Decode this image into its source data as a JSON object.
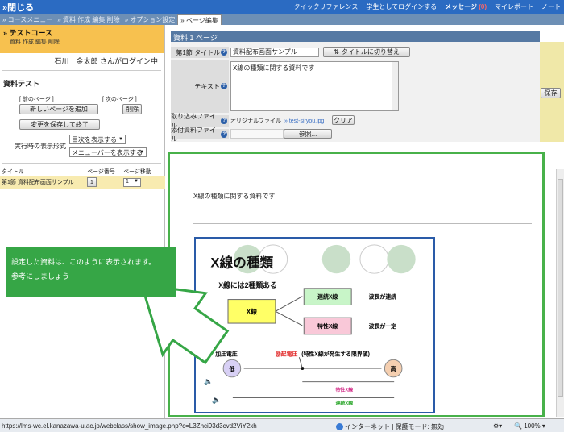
{
  "topbar": {
    "close": "»閉じる",
    "quick_ref": "クイックリファレンス",
    "student_login": "学生としてログインする",
    "messages": "メッセージ",
    "message_count": "(0)",
    "my_report": "マイレポート",
    "note": "ノート"
  },
  "tabs": [
    {
      "label": "» コースメニュー"
    },
    {
      "label": "» 資料 作成 編集 削除"
    },
    {
      "label": "» オプション設定"
    },
    {
      "label": "» ページ編集"
    }
  ],
  "course": {
    "title": "» テストコース",
    "subtitle": "資料 作成 編集 削除",
    "login": "石川　金太郎 さんがログイン中"
  },
  "material": {
    "title": "資料テスト",
    "prev_page": "[ 前のページ ]",
    "next_page": "[ 次のページ ]",
    "add_page": "新しいページを追加",
    "delete": "削除",
    "save_finish": "変更を保存して終了",
    "display_format_label": "実行時の表示形式",
    "toc_option": "目次を表示する",
    "menu_option": "メニューバーを表示する"
  },
  "page_table": {
    "col_title": "タイトル",
    "col_pageno": "ページ番号",
    "col_move": "ページ移動",
    "rows": [
      {
        "title": "第1節 資料配布画面サンプル",
        "pageno": "1",
        "move": "1"
      }
    ]
  },
  "editor": {
    "header": "資料 1 ページ",
    "title_label": "第1節 タイトル",
    "title_value": "資料配布画面サンプル",
    "switch_title": "タイトルに切り替え",
    "text_label": "テキスト",
    "text_value": "X線の種類に関する資料です",
    "import_label": "取り込みファイル",
    "original_file": "オリジナルファイル",
    "file_name": "» test-siryou.jpg",
    "clear": "クリア",
    "attach_label": "添付資料ファイル",
    "browse": "参照...",
    "save": "保存"
  },
  "preview": {
    "text": "X線の種類に関する資料です"
  },
  "slide": {
    "title": "X線の種類",
    "subtitle": "X線には2種類ある",
    "xray": "X線",
    "continuous": "連続X線",
    "continuous_desc": "波長が連続",
    "characteristic": "特性X線",
    "characteristic_desc": "波長が一定",
    "voltage": "加圧電圧",
    "excitation": "励起電圧",
    "excitation_note": "(特性X線が発生する限界値)",
    "low": "低",
    "high": "高",
    "char_bar": "特性X線",
    "cont_bar": "連続X線"
  },
  "callout": {
    "line1": "設定した資料は、このように表示されます。",
    "line2": "参考にしましょう"
  },
  "statusbar": {
    "url": "https://lms-wc.el.kanazawa-u.ac.jp/webclass/show_image.php?c=L3Zhci93d3cvd2ViY2xh",
    "zone": "インターネット | 保護モード: 無効",
    "zoom": "100%"
  },
  "colors": {
    "topbar": "#2b6bc2",
    "course_box": "#f7c14f",
    "callout": "#36a646",
    "editor_header": "#5679a3"
  }
}
